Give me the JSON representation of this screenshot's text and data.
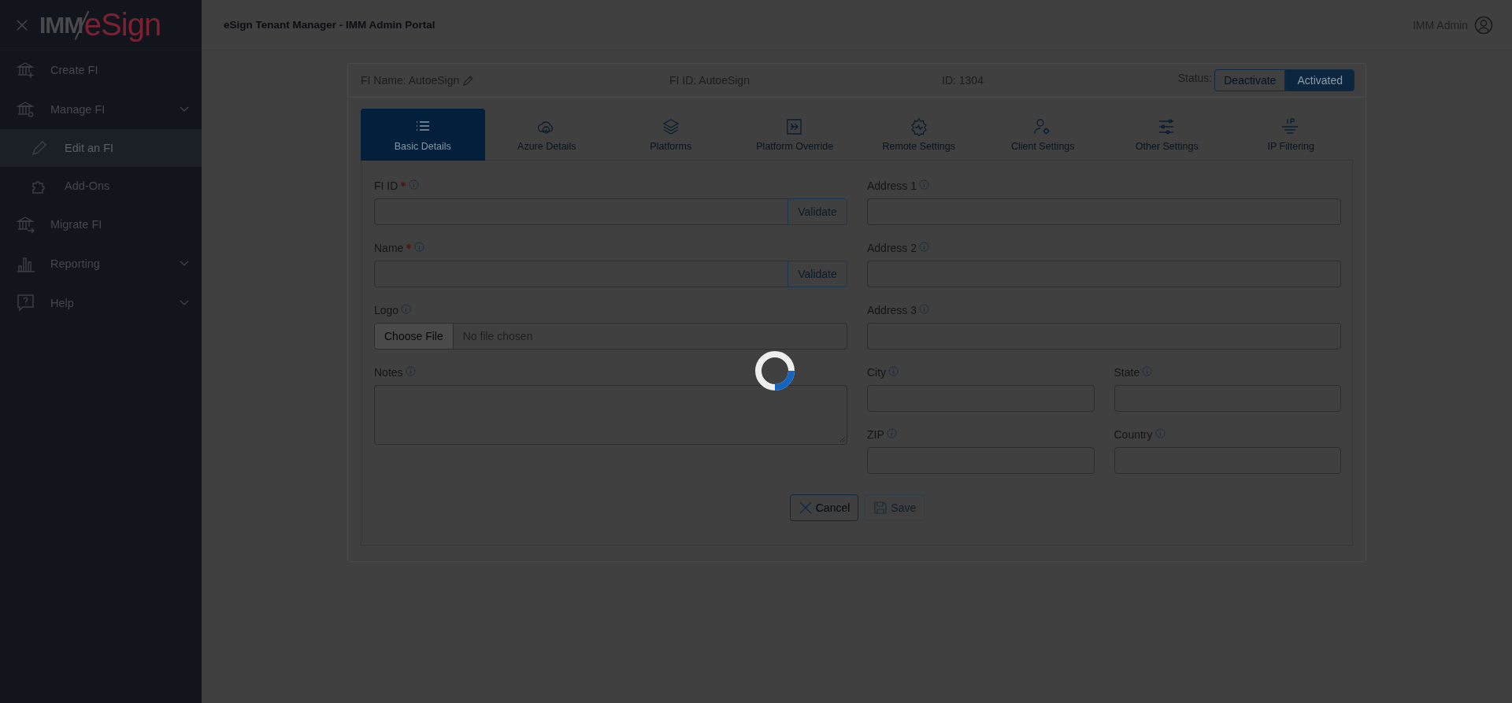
{
  "sidebar": {
    "logo": {
      "prefix": "IMM",
      "suffix": "eSign"
    },
    "items": [
      {
        "label": "Create FI",
        "selected": false,
        "collapsible": false
      },
      {
        "label": "Manage FI",
        "selected": false,
        "collapsible": true,
        "children": [
          {
            "label": "Edit an FI",
            "selected": true
          },
          {
            "label": "Add-Ons",
            "selected": false
          }
        ]
      },
      {
        "label": "Migrate FI",
        "selected": false,
        "collapsible": false
      },
      {
        "label": "Reporting",
        "selected": false,
        "collapsible": true
      },
      {
        "label": "Help",
        "selected": false,
        "collapsible": true
      }
    ]
  },
  "header": {
    "title": "eSign Tenant Manager - IMM Admin Portal",
    "user": "IMM Admin"
  },
  "fi_bar": {
    "name": "FI Name: AutoeSign",
    "fi_id": "FI ID: AutoeSign",
    "id": "ID: 1304",
    "status_label": "Status:",
    "status_options": [
      {
        "label": "Deactivate",
        "selected": false
      },
      {
        "label": "Activated",
        "selected": true
      }
    ]
  },
  "tabs": [
    {
      "label": "Basic Details",
      "selected": true
    },
    {
      "label": "Azure Details",
      "selected": false
    },
    {
      "label": "Platforms",
      "selected": false
    },
    {
      "label": "Platform Override",
      "selected": false
    },
    {
      "label": "Remote Settings",
      "selected": false
    },
    {
      "label": "Client Settings",
      "selected": false
    },
    {
      "label": "Other Settings",
      "selected": false
    },
    {
      "label": "IP Filtering",
      "selected": false
    }
  ],
  "form": {
    "left": [
      {
        "kind": "validate",
        "label": "FI ID",
        "required": true,
        "button": "Validate"
      },
      {
        "kind": "validate",
        "label": "Name",
        "required": true,
        "button": "Validate"
      },
      {
        "kind": "file",
        "label": "Logo",
        "required": false,
        "button": "Choose File",
        "value": "No file chosen"
      },
      {
        "kind": "textarea",
        "label": "Notes",
        "required": false
      }
    ],
    "right": [
      [
        {
          "kind": "text",
          "label": "Address 1",
          "required": false
        }
      ],
      [
        {
          "kind": "text",
          "label": "Address 2",
          "required": false
        }
      ],
      [
        {
          "kind": "text",
          "label": "Address 3",
          "required": false
        }
      ],
      [
        {
          "kind": "text",
          "label": "City",
          "required": false
        },
        {
          "kind": "text",
          "label": "State",
          "required": false
        }
      ],
      [
        {
          "kind": "text",
          "label": "ZIP",
          "required": false
        },
        {
          "kind": "text",
          "label": "Country",
          "required": false
        }
      ]
    ]
  },
  "actions": [
    {
      "label": "Cancel",
      "disabled": false
    },
    {
      "label": "Save",
      "disabled": true
    }
  ],
  "loading": true
}
